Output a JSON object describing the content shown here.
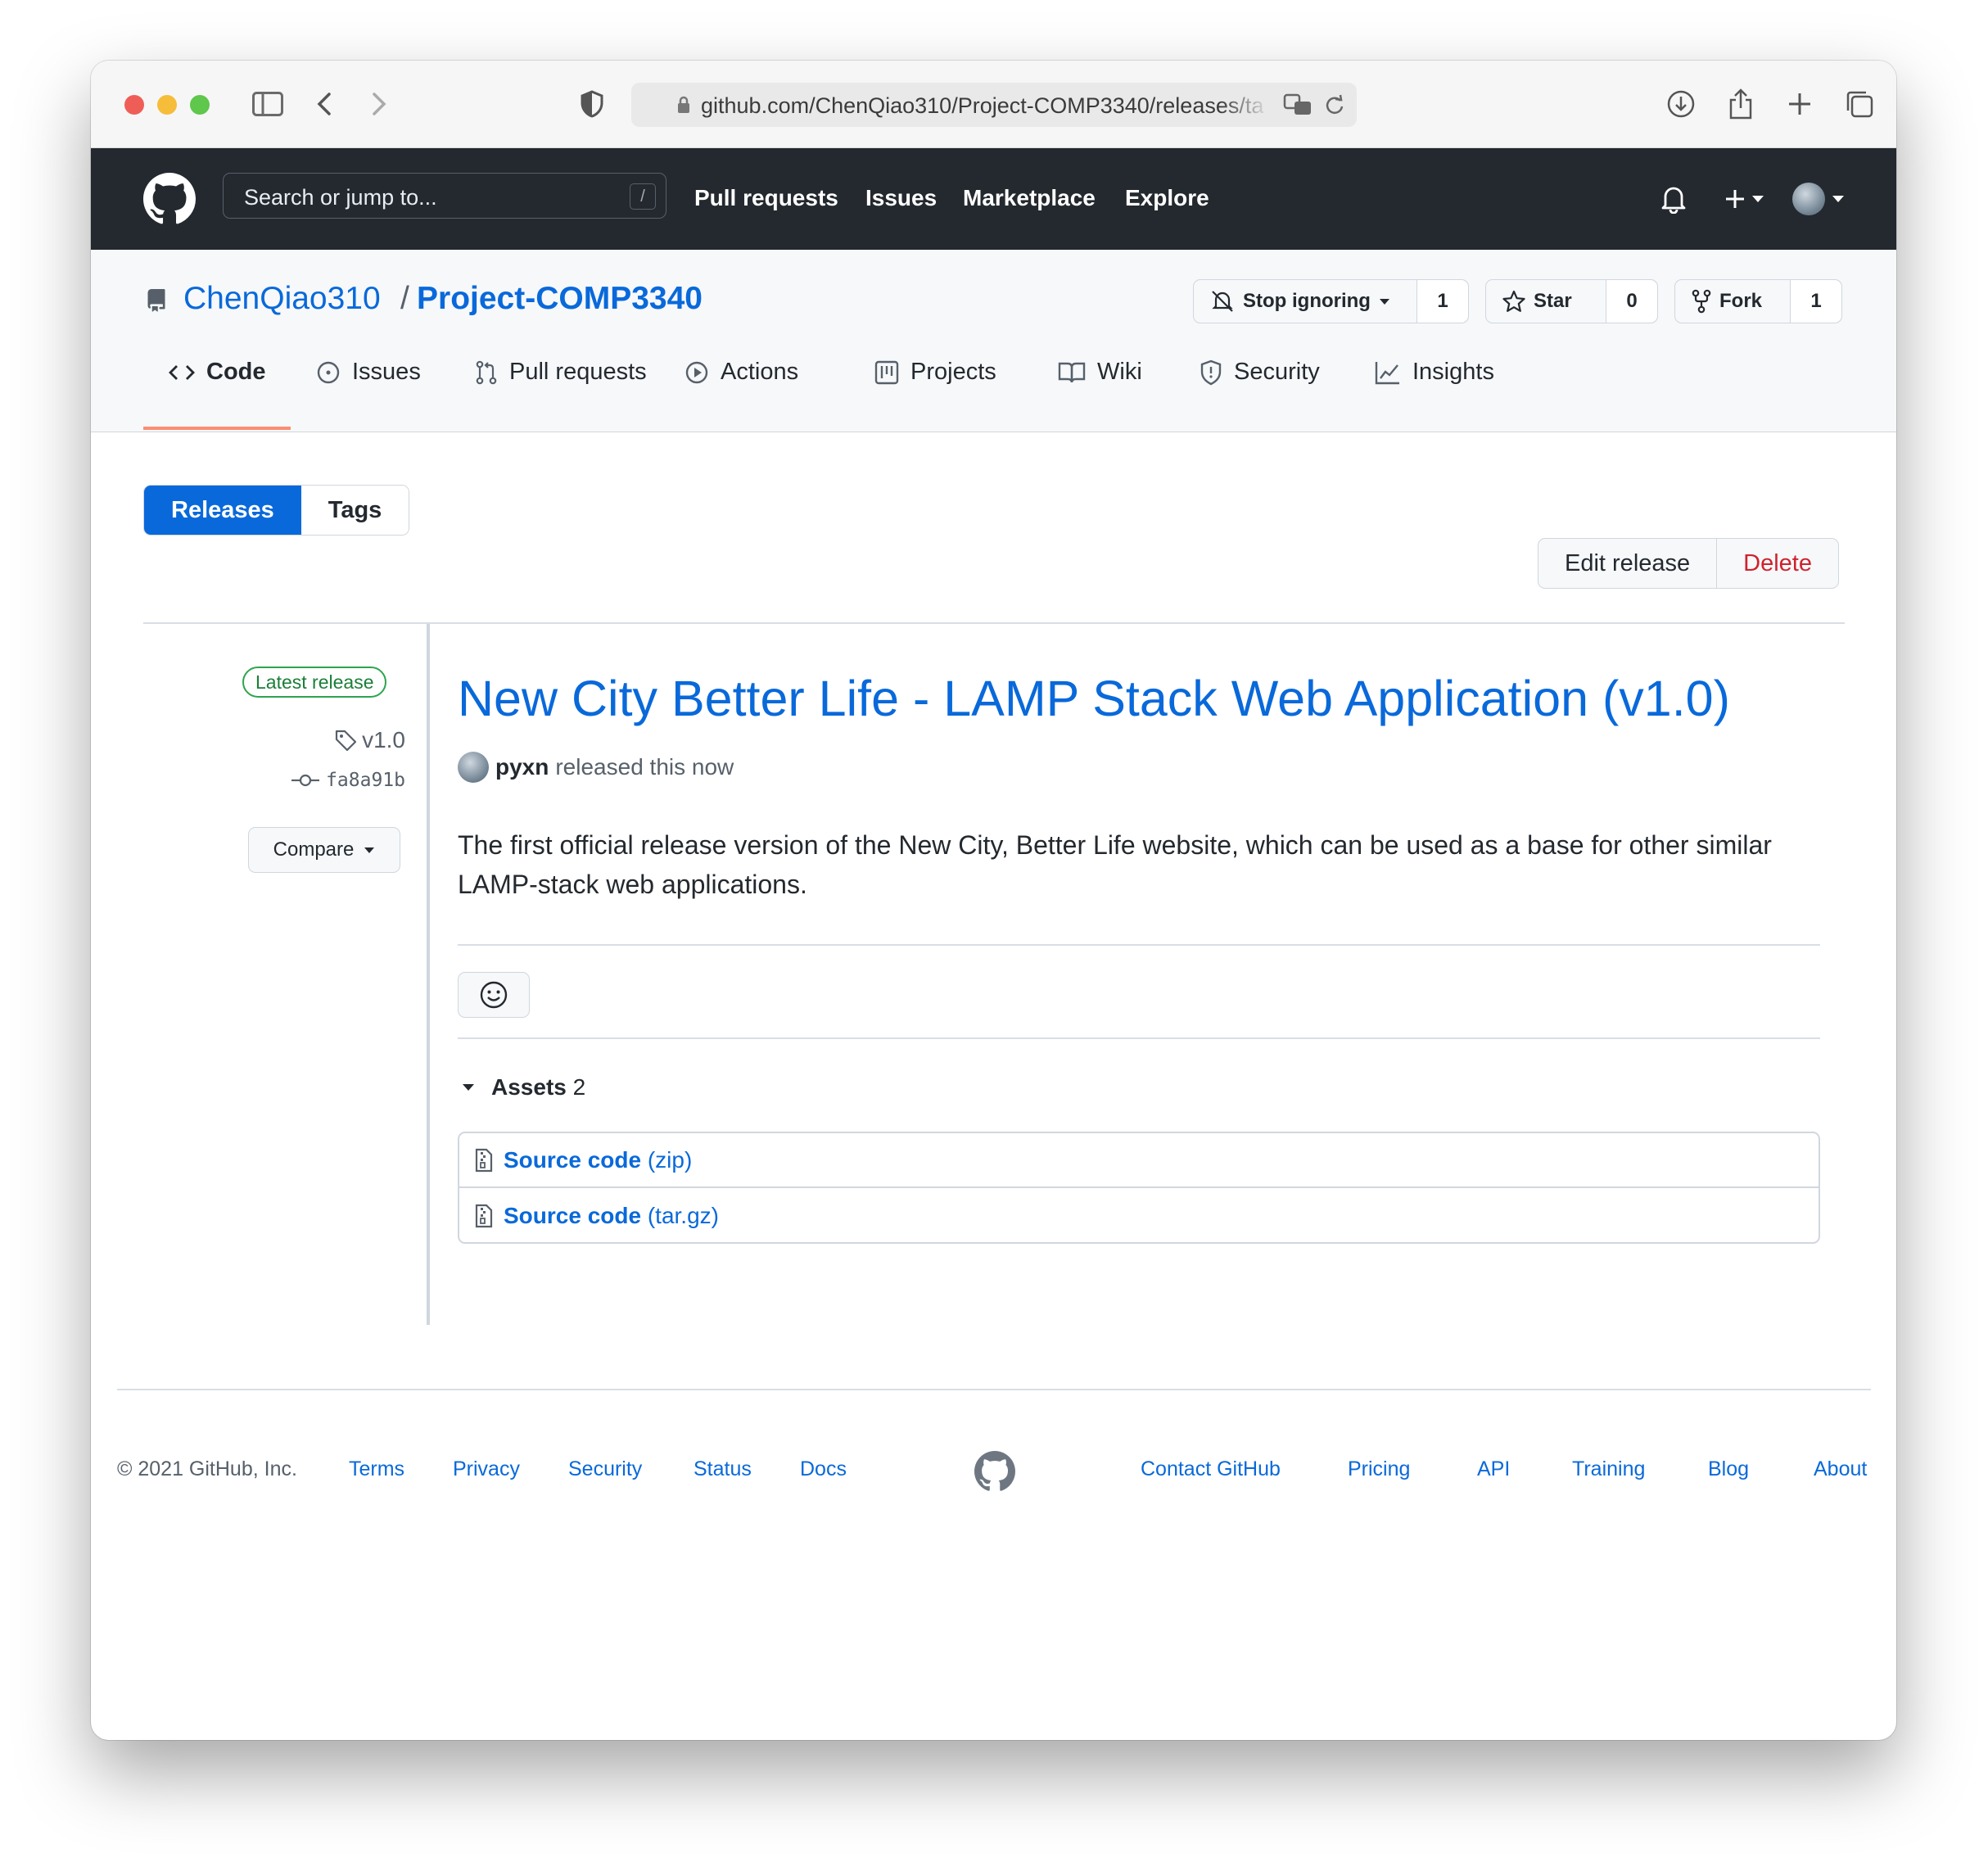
{
  "browser": {
    "url": "github.com/ChenQiao310/Project-COMP3340/releases/ta"
  },
  "header": {
    "search_placeholder": "Search or jump to...",
    "search_shortcut": "/",
    "nav": [
      "Pull requests",
      "Issues",
      "Marketplace",
      "Explore"
    ]
  },
  "repo": {
    "owner": "ChenQiao310",
    "separator": "/",
    "name": "Project-COMP3340",
    "watch": {
      "label": "Stop ignoring",
      "count": "1"
    },
    "star": {
      "label": "Star",
      "count": "0"
    },
    "fork": {
      "label": "Fork",
      "count": "1"
    },
    "tabs": [
      "Code",
      "Issues",
      "Pull requests",
      "Actions",
      "Projects",
      "Wiki",
      "Security",
      "Insights"
    ],
    "active_tab": "Code"
  },
  "release_nav": {
    "releases": "Releases",
    "tags": "Tags"
  },
  "release_actions": {
    "edit": "Edit release",
    "delete": "Delete"
  },
  "release": {
    "badge": "Latest release",
    "tag": "v1.0",
    "commit": "fa8a91b",
    "compare": "Compare",
    "title": "New City Better Life - LAMP Stack Web Application (v1.0)",
    "author": "pyxn",
    "released_text": "released this now",
    "description": "The first official release version of the New City, Better Life website, which can be used as a base for other similar LAMP-stack web applications.",
    "assets_label": "Assets",
    "assets_count": "2",
    "assets": [
      {
        "name": "Source code",
        "ext": "(zip)"
      },
      {
        "name": "Source code",
        "ext": "(tar.gz)"
      }
    ]
  },
  "footer": {
    "copyright": "© 2021 GitHub, Inc.",
    "left_links": [
      "Terms",
      "Privacy",
      "Security",
      "Status",
      "Docs"
    ],
    "right_links": [
      "Contact GitHub",
      "Pricing",
      "API",
      "Training",
      "Blog",
      "About"
    ]
  },
  "colors": {
    "accent": "#0969da",
    "header_bg": "#24292f",
    "danger": "#cf222e",
    "success": "#1a7f37",
    "tab_underline": "#fd8c73"
  }
}
